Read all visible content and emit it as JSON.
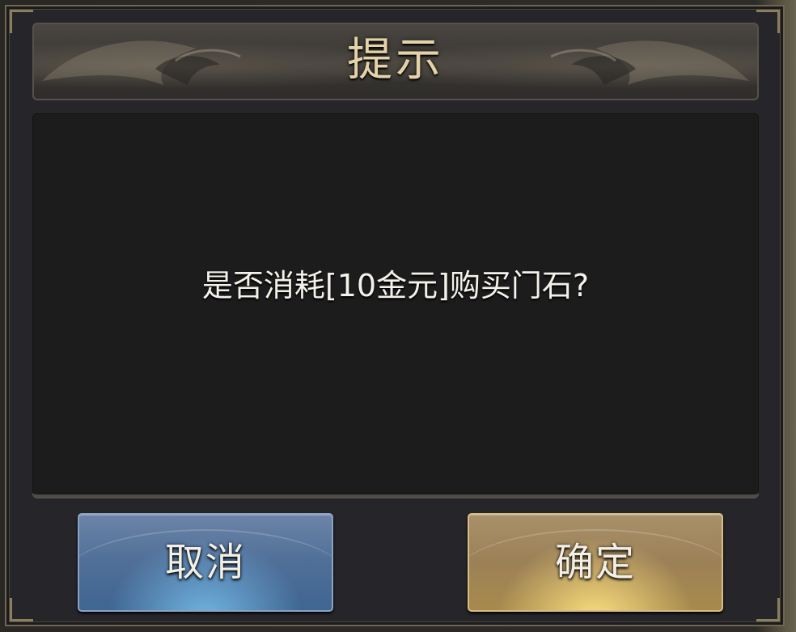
{
  "dialog": {
    "title": "提示",
    "message": "是否消耗[10金元]购买门石?"
  },
  "buttons": {
    "cancel_label": "取消",
    "confirm_label": "确定"
  },
  "colors": {
    "title_text": "#e4d3a8",
    "message_text": "#f4f1ea",
    "cancel_button": "#4f6f98",
    "confirm_button": "#9c8157",
    "frame_border": "#6e6652",
    "panel_background": "#1c1c1d"
  },
  "icons": [
    "title-ornament-left-icon",
    "title-ornament-right-icon"
  ]
}
